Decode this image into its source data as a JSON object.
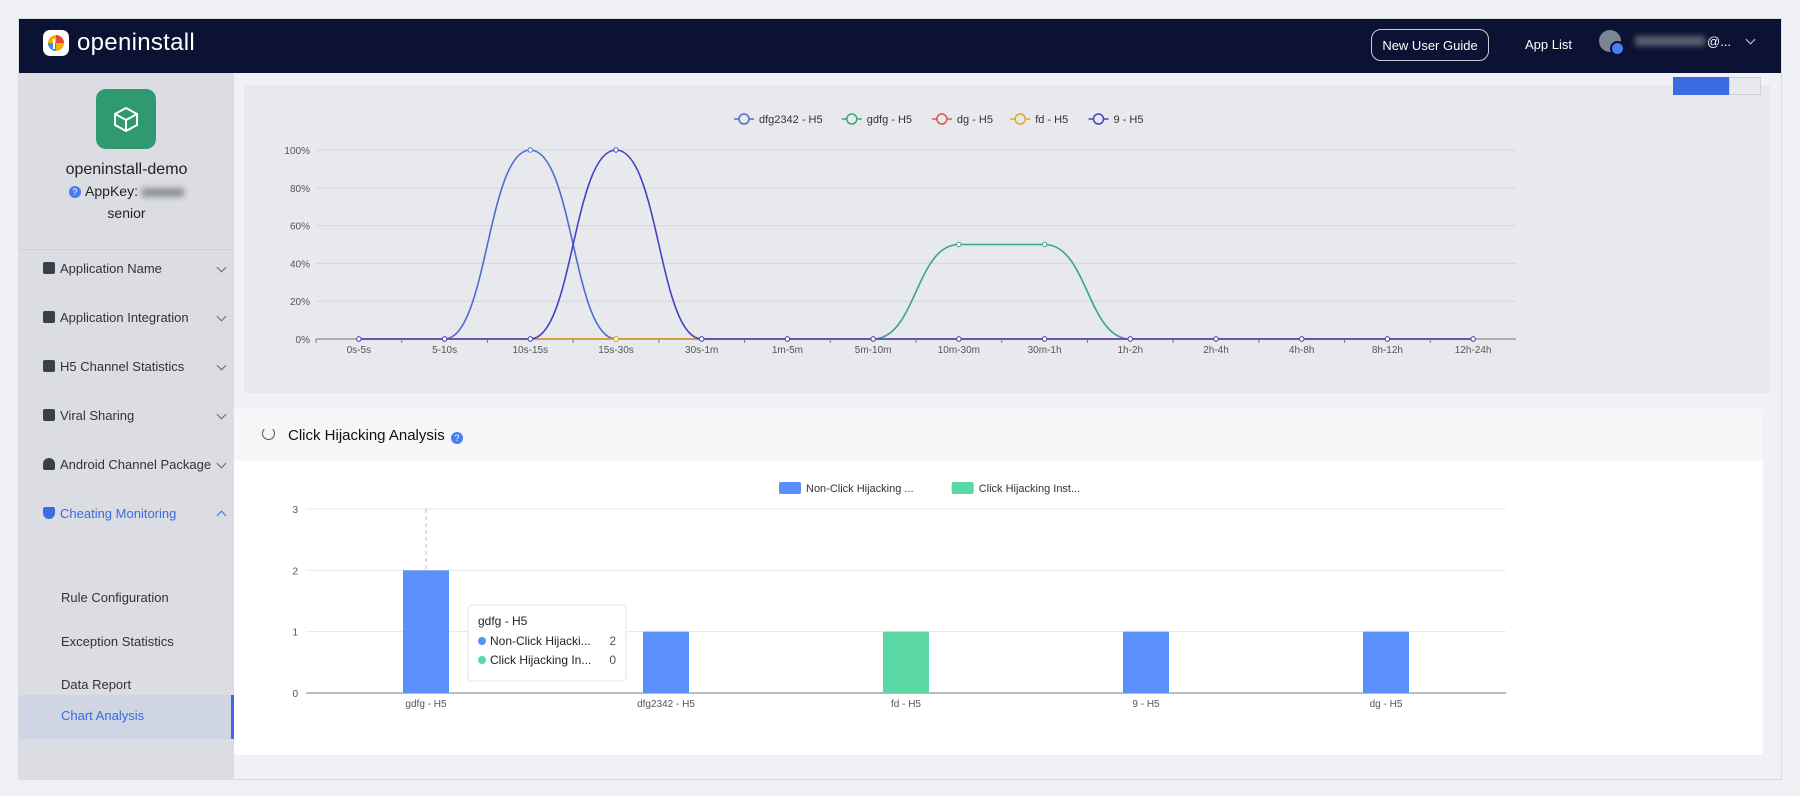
{
  "header": {
    "logo_text": "openinstall",
    "guide_button": "New User Guide",
    "app_list": "App List",
    "user_suffix": "@..."
  },
  "app": {
    "name": "openinstall-demo",
    "appkey_label": "AppKey:",
    "tier": "senior"
  },
  "sidebar": {
    "items": [
      {
        "label": "Application Name"
      },
      {
        "label": "Application Integration"
      },
      {
        "label": "H5 Channel Statistics"
      },
      {
        "label": "Viral Sharing"
      },
      {
        "label": "Android Channel Package"
      },
      {
        "label": "Cheating Monitoring"
      }
    ],
    "sub_items": [
      {
        "label": "Rule Configuration"
      },
      {
        "label": "Exception Statistics"
      },
      {
        "label": "Data Report"
      },
      {
        "label": "Chart Analysis"
      }
    ]
  },
  "panel2": {
    "title": "Click Hijacking Analysis"
  },
  "colors": {
    "nav": "#0c1233",
    "accent": "#3a6be0",
    "blue_bar": "#5b8ff9",
    "green_bar": "#5ad8a6"
  },
  "chart_data": [
    {
      "type": "line",
      "x": [
        "0s-5s",
        "5-10s",
        "10s-15s",
        "15s-30s",
        "30s-1m",
        "1m-5m",
        "5m-10m",
        "10m-30m",
        "30m-1h",
        "1h-2h",
        "2h-4h",
        "4h-8h",
        "8h-12h",
        "12h-24h"
      ],
      "yticks": [
        "0%",
        "20%",
        "40%",
        "60%",
        "80%",
        "100%"
      ],
      "ylim": [
        0,
        100
      ],
      "series": [
        {
          "name": "dfg2342 - H5",
          "color": "#4a6fd1",
          "values": [
            0,
            0,
            100,
            0,
            0,
            0,
            0,
            0,
            0,
            0,
            0,
            0,
            0,
            0
          ]
        },
        {
          "name": "gdfg - H5",
          "color": "#3aa77e",
          "values": [
            0,
            0,
            0,
            0,
            0,
            0,
            0,
            50,
            50,
            0,
            0,
            0,
            0,
            0
          ]
        },
        {
          "name": "dg - H5",
          "color": "#d9574f",
          "values": [
            0,
            0,
            0,
            0,
            0,
            0,
            0,
            0,
            0,
            0,
            0,
            0,
            0,
            0
          ]
        },
        {
          "name": "fd - H5",
          "color": "#e3a52c",
          "values": [
            0,
            0,
            0,
            0,
            0,
            0,
            0,
            0,
            0,
            0,
            0,
            0,
            0,
            0
          ]
        },
        {
          "name": "9 - H5",
          "color": "#4a3fc9",
          "values": [
            0,
            0,
            0,
            100,
            0,
            0,
            0,
            0,
            0,
            0,
            0,
            0,
            0,
            0
          ]
        }
      ]
    },
    {
      "type": "bar",
      "categories": [
        "gdfg - H5",
        "dfg2342 - H5",
        "fd - H5",
        "9 - H5",
        "dg - H5"
      ],
      "ylim": [
        0,
        3
      ],
      "yticks": [
        "0",
        "1",
        "2",
        "3"
      ],
      "series": [
        {
          "name": "Non-Click Hijacking ...",
          "color": "#5b8ff9",
          "values": [
            2,
            1,
            0,
            1,
            1
          ]
        },
        {
          "name": "Click Hijacking Inst...",
          "color": "#5ad8a6",
          "values": [
            0,
            0,
            1,
            0,
            0
          ]
        }
      ],
      "tooltip": {
        "title": "gdfg - H5",
        "rows": [
          {
            "label": "Non-Click Hijacki...",
            "value": "2"
          },
          {
            "label": "Click Hijacking In...",
            "value": "0"
          }
        ]
      }
    }
  ]
}
